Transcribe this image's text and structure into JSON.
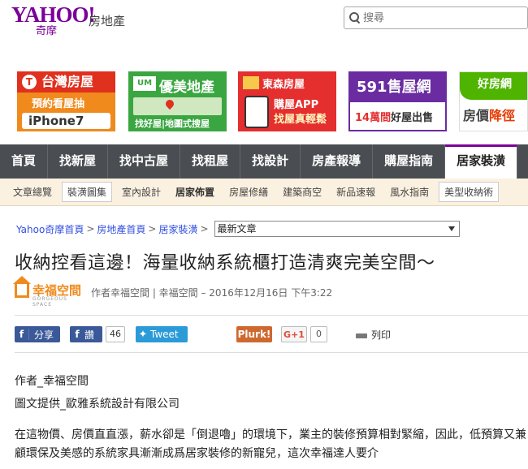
{
  "header": {
    "logo_text": "YAHOO!",
    "logo_sub": "奇摩",
    "section": "房地產",
    "search_placeholder": "搜尋"
  },
  "ads": {
    "taiwan_house": {
      "brand": "台灣房屋",
      "line1": "預約看屋抽",
      "line2": "iPhone7"
    },
    "yumei": {
      "brand": "優美地產",
      "line1": "找好屋|地圖式搜屋"
    },
    "dongsen": {
      "brand": "東森房屋",
      "line1": "購屋APP",
      "line2": "找屋真輕鬆"
    },
    "house591": {
      "brand": "591售屋網",
      "line1_prefix": "14萬間",
      "line1_suffix": "好屋出售"
    },
    "housefun": {
      "brand": "好房網",
      "line1_prefix": "房價",
      "line1_suffix": "降徑"
    }
  },
  "main_nav": [
    "首頁",
    "找新屋",
    "找中古屋",
    "找租屋",
    "找設計",
    "房產報導",
    "購屋指南",
    "居家裝潢"
  ],
  "main_nav_active": "居家裝潢",
  "sub_nav": [
    "文章總覽",
    "裝潢圖集",
    "室內設計",
    "居家佈置",
    "房屋修繕",
    "建築商空",
    "新品速報",
    "風水指南",
    "美型收納術"
  ],
  "breadcrumb": {
    "items": [
      "Yahoo奇摩首頁",
      "房地產首頁",
      "居家裝潢"
    ],
    "select_value": "最新文章"
  },
  "article": {
    "title": "收納控看這邊！海量收納系統櫃打造清爽完美空間～",
    "publisher_name": "幸福空間",
    "publisher_en": "GORGEOUS SPACE",
    "byline": "作者幸福空間 | 幸福空間 – 2016年12月16日 下午3:22",
    "author_line": "作者_幸福空間",
    "credit_line": "圖文提供_歐雅系統設計有限公司",
    "body": "在這物價、房價直直漲，薪水卻是「倒退嚕」的環境下，業主的裝修預算相對緊縮，因此，低預算又兼顧環保及美感的系統家具漸漸成爲居家裝修的新寵兒，這次幸福達人要介"
  },
  "social": {
    "share_label": "分享",
    "fb_label": "讚",
    "fb_count": "46",
    "tweet_label": "Tweet",
    "plurk_label": "Plurk!",
    "gplus_label": "G+1",
    "gplus_count": "0",
    "print_label": "列印"
  },
  "colors": {
    "yahoo_purple": "#7b0099",
    "nav_bg": "#4a4d51",
    "subnav_bg": "#fbf1e0",
    "facebook": "#3b5998",
    "twitter": "#2b9bd8",
    "plurk": "#cf682f",
    "publisher_orange": "#f08a1c"
  }
}
